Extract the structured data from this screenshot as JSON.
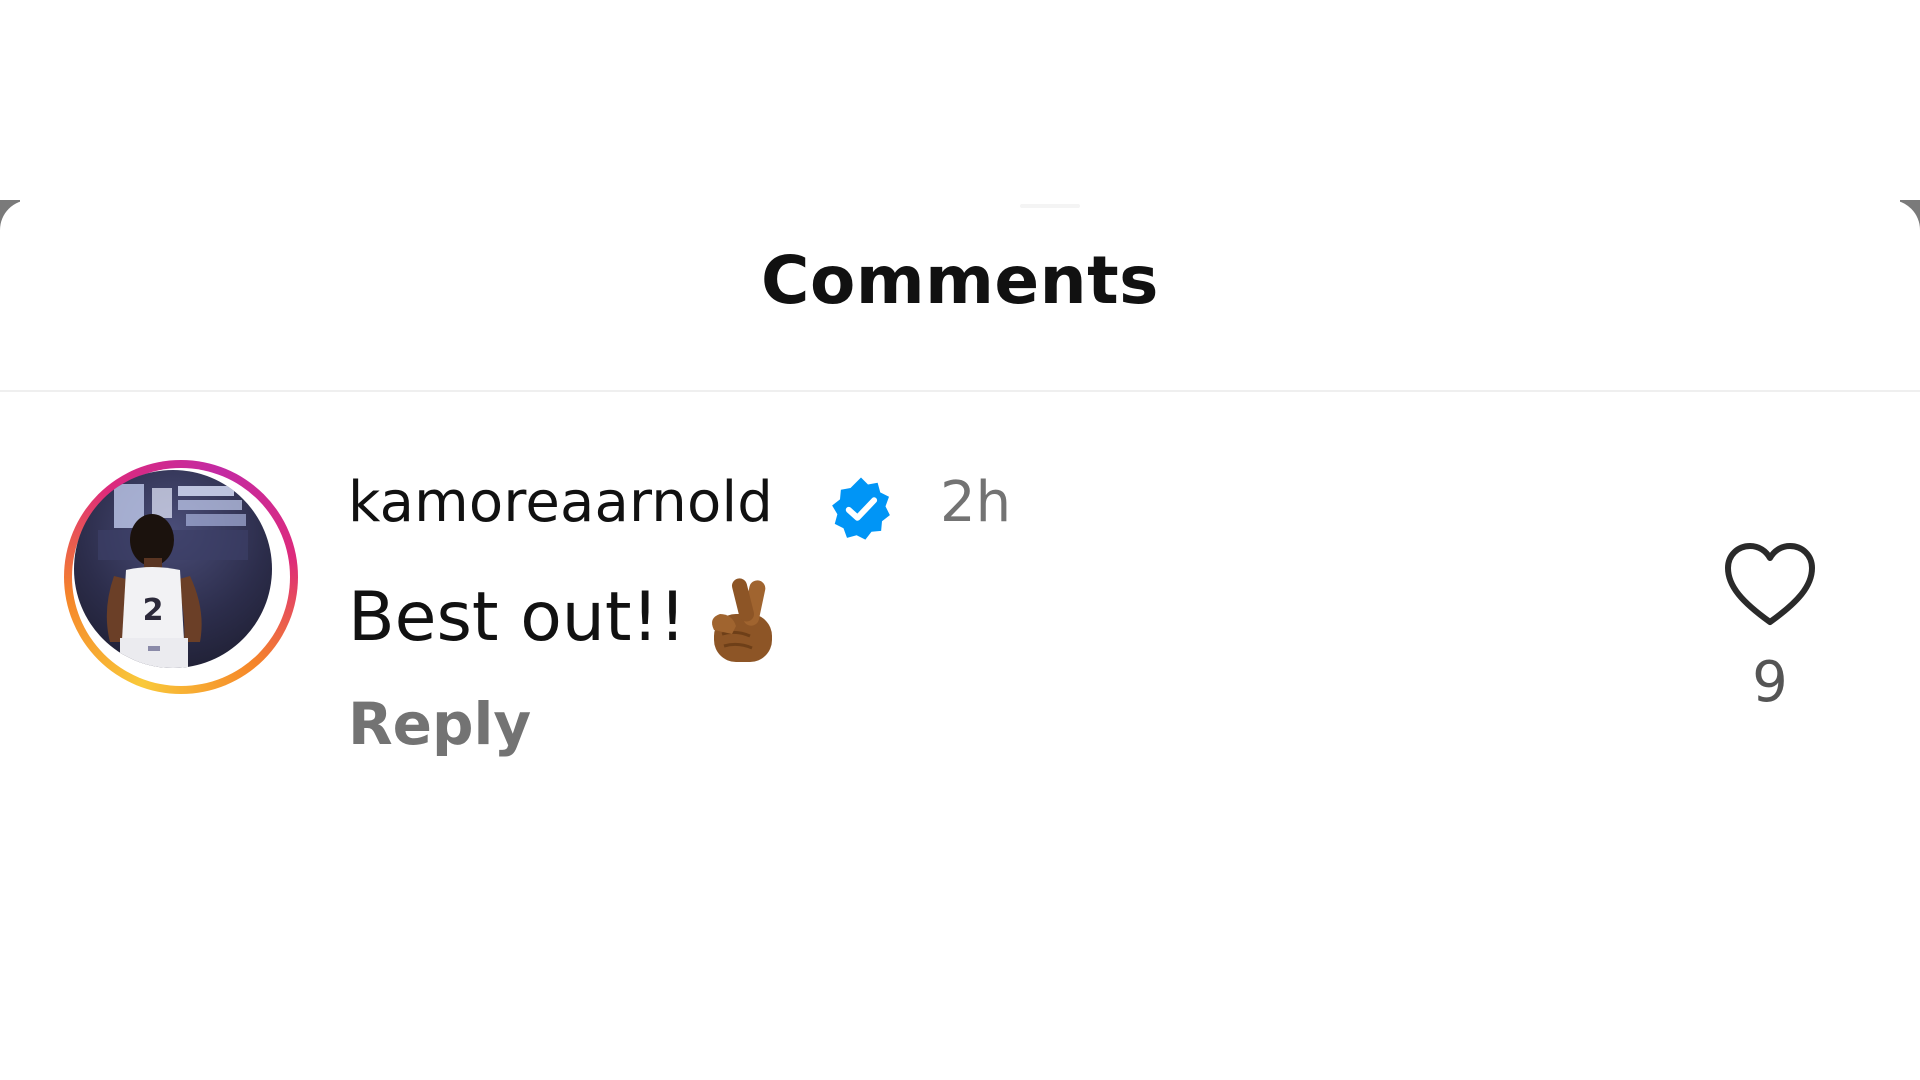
{
  "sheet": {
    "title": "Comments"
  },
  "comment": {
    "username": "kamoreaarnold",
    "verified_icon": "verified-badge-icon",
    "timestamp": "2h",
    "text": "Best out!!",
    "emoji_icon": "crossed-fingers-icon",
    "reply_label": "Reply",
    "like_icon": "heart-outline-icon",
    "like_count": "9",
    "avatar_icon": "player-number-2-avatar"
  },
  "colors": {
    "text_primary": "#111111",
    "text_secondary": "#737373",
    "verified_blue": "#0095f6",
    "avatar_ring_start": "#f9c93a",
    "avatar_ring_end": "#c32aa3",
    "backdrop": "#7a7a7a"
  }
}
